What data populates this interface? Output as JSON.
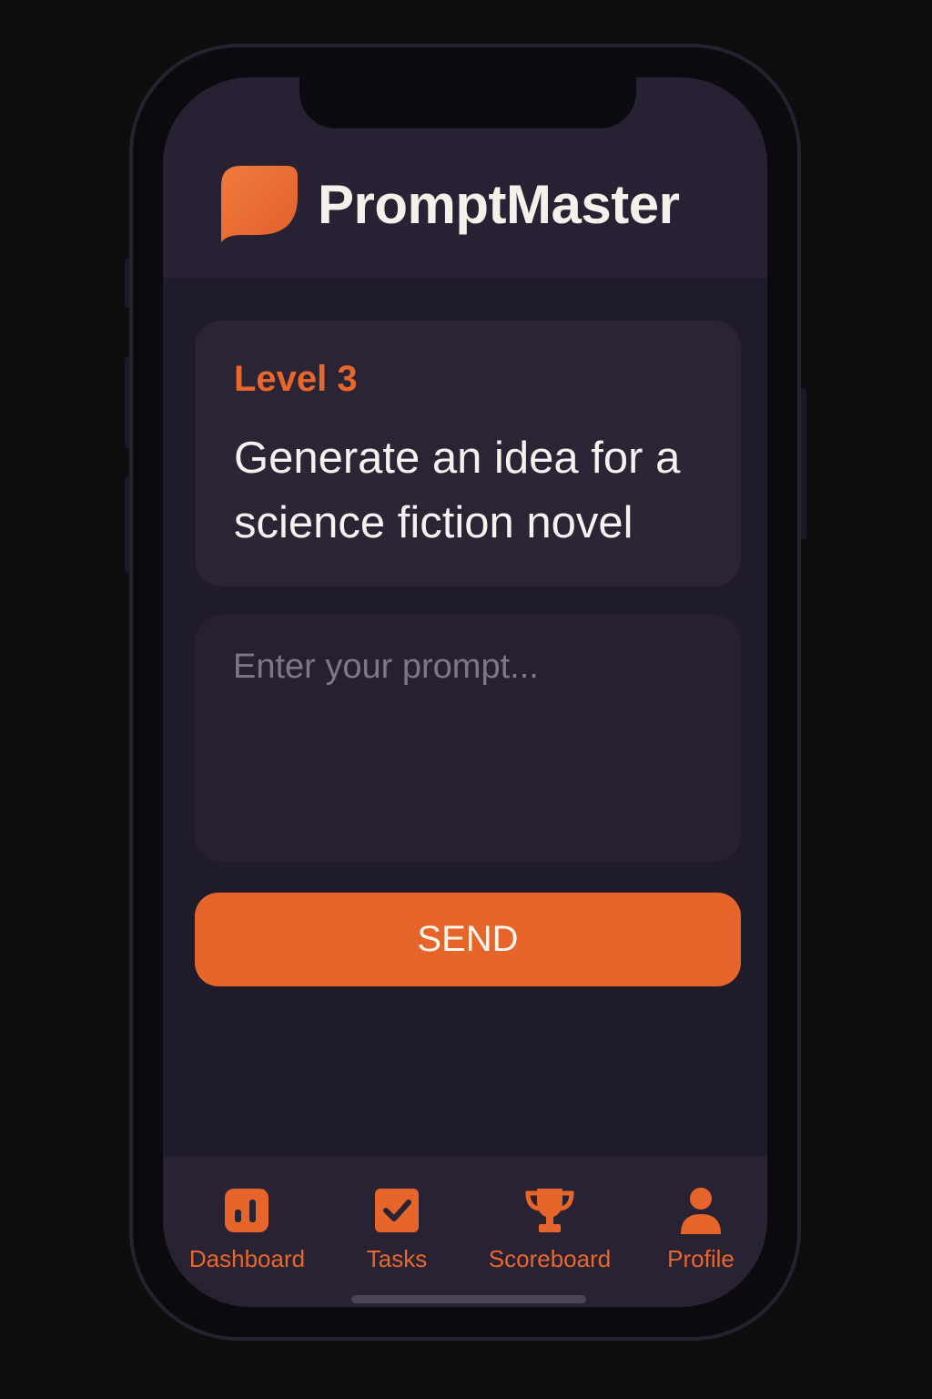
{
  "app": {
    "title": "PromptMaster",
    "logo_icon": "speech-bubble-leaf-icon"
  },
  "task": {
    "level_label": "Level 3",
    "text": "Generate an idea for a science fiction novel"
  },
  "prompt": {
    "value": "",
    "placeholder": "Enter your prompt..."
  },
  "send_button": {
    "label": "SEND"
  },
  "tabs": [
    {
      "label": "Dashboard",
      "icon": "bar-chart-icon"
    },
    {
      "label": "Tasks",
      "icon": "checkbox-icon"
    },
    {
      "label": "Scoreboard",
      "icon": "trophy-icon"
    },
    {
      "label": "Profile",
      "icon": "person-icon"
    }
  ],
  "colors": {
    "accent": "#E5652A",
    "background": "#201B2A",
    "card": "#2A2435",
    "text": "#F5F3F0",
    "placeholder": "#7E7886"
  }
}
